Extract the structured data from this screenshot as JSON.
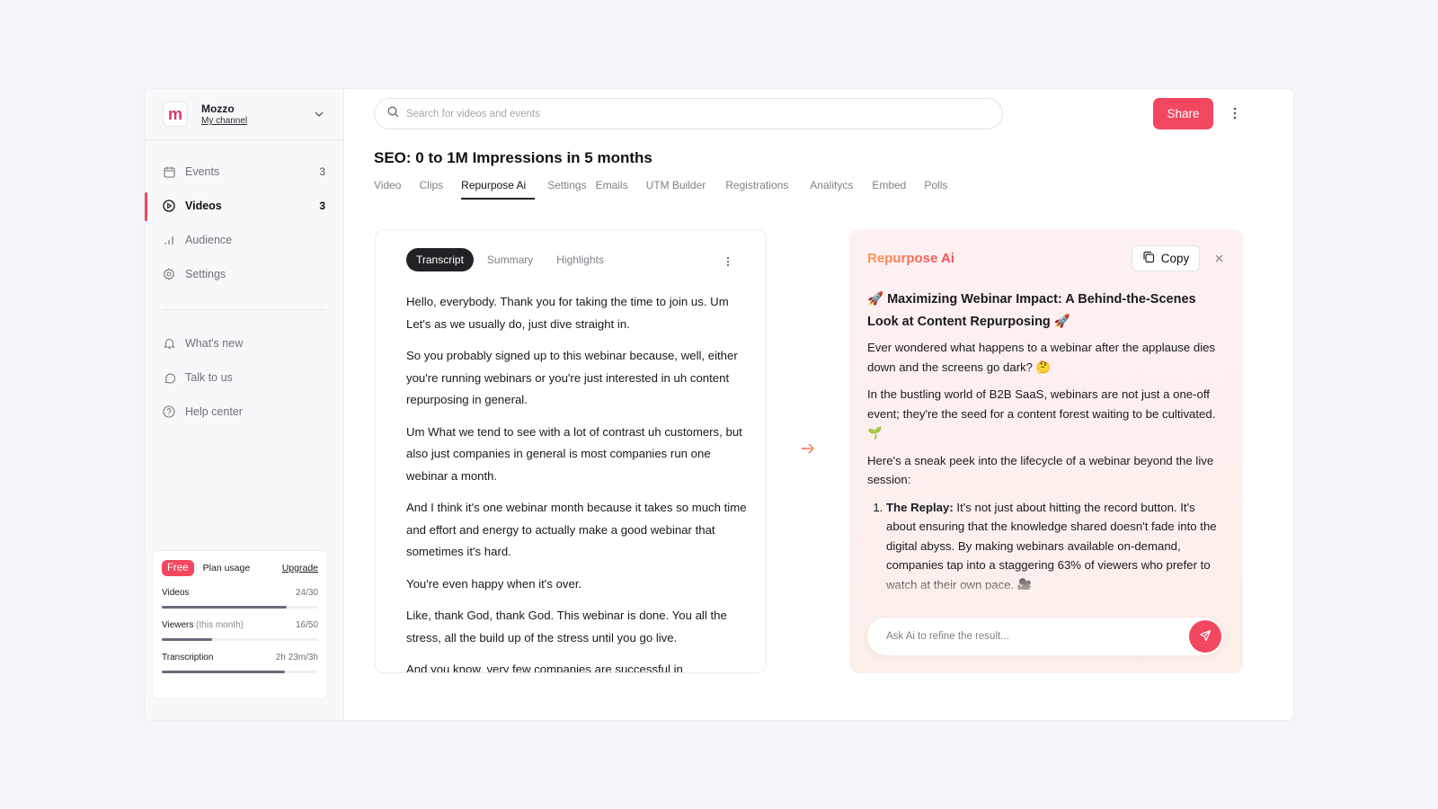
{
  "channel": {
    "name": "Mozzo",
    "subtitle": "My channel",
    "logo_letter": "m"
  },
  "sidebar": {
    "items": [
      {
        "label": "Events",
        "count": "3",
        "icon": "calendar-icon",
        "active": false
      },
      {
        "label": "Videos",
        "count": "3",
        "icon": "play-circle-icon",
        "active": true
      },
      {
        "label": "Audience",
        "count": "",
        "icon": "bar-chart-icon",
        "active": false
      },
      {
        "label": "Settings",
        "count": "",
        "icon": "gear-icon",
        "active": false
      }
    ],
    "secondary": [
      {
        "label": "What's new",
        "icon": "bell-icon"
      },
      {
        "label": "Talk to us",
        "icon": "chat-bubble-icon"
      },
      {
        "label": "Help center",
        "icon": "help-circle-icon"
      }
    ]
  },
  "plan": {
    "badge": "Free",
    "title": "Plan usage",
    "upgrade": "Upgrade",
    "usage": [
      {
        "label": "Videos",
        "suffix": "",
        "value": "24/30",
        "fraction": 0.8
      },
      {
        "label": "Viewers",
        "suffix": "(this month)",
        "value": "16/50",
        "fraction": 0.32
      },
      {
        "label": "Transcription",
        "suffix": "",
        "value": "2h 23m/3h",
        "fraction": 0.79
      }
    ]
  },
  "header": {
    "search_placeholder": "Search for videos and events",
    "share_label": "Share"
  },
  "page": {
    "title": "SEO: 0 to 1M Impressions in 5 months",
    "tabs": [
      "Video",
      "Clips",
      "Repurpose Ai",
      "Settings",
      "Emails",
      "UTM Builder",
      "Registrations",
      "Analitycs",
      "Embed",
      "Polls"
    ],
    "active_tab": "Repurpose Ai"
  },
  "transcript": {
    "tabs": [
      "Transcript",
      "Summary",
      "Highlights"
    ],
    "active_tab": "Transcript",
    "paragraphs": [
      "Hello, everybody. Thank you for taking the time to join us. Um Let's as we usually do, just dive straight in.",
      "So you probably signed up to this webinar because, well, either you're running webinars or you're just interested in uh content repurposing in general.",
      "Um What we tend to see with a lot of contrast uh customers, but also just companies in general is most companies run one webinar a month.",
      "And I think it's one webinar month because it takes so much time and effort and energy to actually make a good webinar that sometimes it's hard.",
      "You're even happy when it's over.",
      "Like, thank God, thank God. This webinar is done. You all the stress, all the build up of the stress until you go live.",
      "And you know, very few companies are successful in"
    ]
  },
  "ai": {
    "title": "Repurpose Ai",
    "copy_label": "Copy",
    "heading": "🚀 Maximizing Webinar Impact: A Behind-the-Scenes Look at Content Repurposing 🚀",
    "paragraphs": [
      "Ever wondered what happens to a webinar after the applause dies down and the screens go dark? 🤔",
      "In the bustling world of B2B SaaS, webinars are not just a one-off event; they're the seed for a content forest waiting to be cultivated. 🌱",
      "Here's a sneak peek into the lifecycle of a webinar beyond the live session:"
    ],
    "list": [
      {
        "title": "The Replay:",
        "text": " It's not just about hitting the record button. It's about ensuring that the knowledge shared doesn't fade into the digital abyss. By making webinars available on-demand, companies tap into a staggering 63% of viewers who prefer to watch at their own pace. 🎥"
      }
    ],
    "input_placeholder": "Ask Ai to refine the result..."
  },
  "colors": {
    "accent": "#f2475f",
    "ai_gradient_start": "#fb9a57",
    "ai_gradient_end": "#f2475f"
  }
}
